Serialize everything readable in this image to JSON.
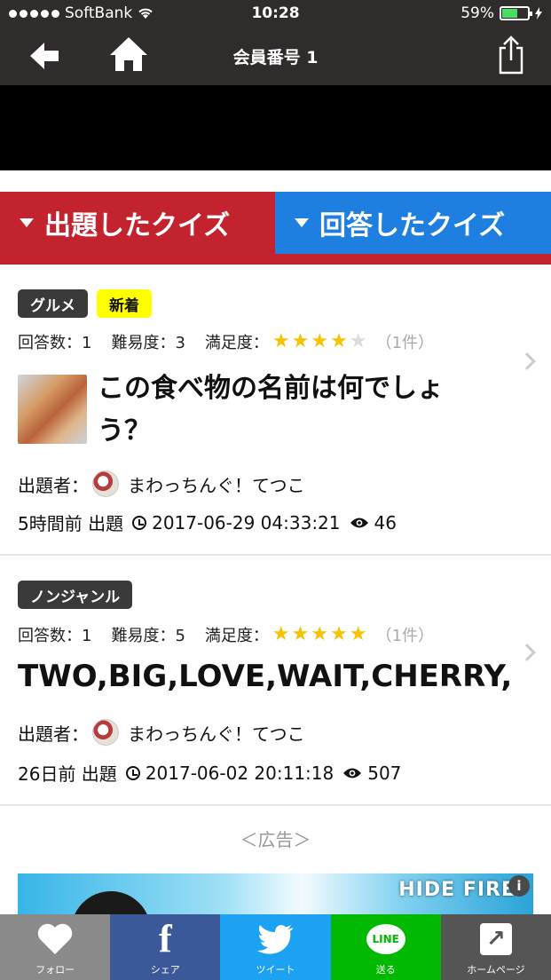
{
  "status_bar": {
    "carrier": "SoftBank",
    "time": "10:28",
    "battery_percent": "59%",
    "battery_level": 0.59
  },
  "nav": {
    "title": "会員番号 1",
    "back_icon": "back-arrow-icon",
    "home_icon": "home-icon",
    "share_icon": "share-icon"
  },
  "tabs": {
    "created": "出題したクイズ",
    "answered": "回答したクイズ"
  },
  "quizzes": [
    {
      "category": "グルメ",
      "badge_new": "新着",
      "answers_label": "回答数：1",
      "difficulty_label": "難易度：3",
      "satisfaction_label": "満足度：",
      "rating": 4,
      "rating_count": "（1件）",
      "title": "この食べ物の名前は何でしょう？",
      "author_label": "出題者：",
      "author": "まわっちんぐ！てつこ",
      "relative": "5時間前 出題",
      "datetime": "2017-06-29 04:33:21",
      "views": "46"
    },
    {
      "category": "ノンジャンル",
      "answers_label": "回答数：1",
      "difficulty_label": "難易度：5",
      "satisfaction_label": "満足度：",
      "rating": 5,
      "rating_count": "（1件）",
      "title": "TWO,BIG,LOVE,WAIT,CHERRY,...",
      "author_label": "出題者：",
      "author": "まわっちんぐ！てつこ",
      "relative": "26日前 出題",
      "datetime": "2017-06-02 20:11:18",
      "views": "507"
    }
  ],
  "ad": {
    "label": "＜広告＞",
    "banner_text": "HIDE FIRE",
    "info": "i"
  },
  "share_bar": {
    "follow": "フォロー",
    "share": "シェア",
    "tweet": "ツイート",
    "send": "送る",
    "homepage": "ホームページ",
    "line_text": "LINE"
  },
  "colors": {
    "nav_bg": "#302c2b",
    "tab_red": "#c3232e",
    "tab_blue": "#1e7fe0",
    "star": "#f7c300",
    "badge_new": "#ffff00"
  }
}
